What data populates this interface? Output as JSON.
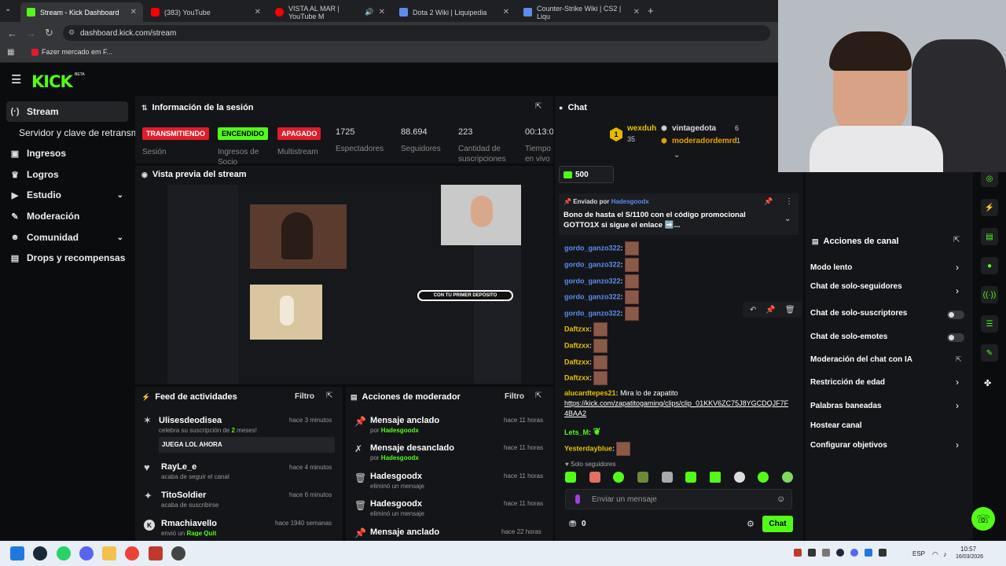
{
  "browser": {
    "tabs": [
      {
        "title": "Stream - Kick Dashboard",
        "color": "#53fc18"
      },
      {
        "title": "(383) YouTube",
        "color": "#ff0000"
      },
      {
        "title": "VISTA AL MAR | YouTube M",
        "color": "#ff0000"
      },
      {
        "title": "Dota 2 Wiki | Liquipedia",
        "color": "#5b8def"
      },
      {
        "title": "Counter-Strike Wiki | CS2 | Liqu",
        "color": "#5b8def"
      }
    ],
    "url": "dashboard.kick.com/stream",
    "bookmark": "Fazer mercado em F..."
  },
  "brand": {
    "logo": "KICK",
    "beta": "BETA"
  },
  "sidebar": {
    "items": [
      {
        "label": "Stream",
        "icon": "broadcast-icon",
        "glyph": "(·)"
      },
      {
        "label": "Servidor y clave de retransm",
        "icon": "",
        "glyph": ""
      },
      {
        "label": "Ingresos",
        "icon": "wallet-icon",
        "glyph": "▣"
      },
      {
        "label": "Logros",
        "icon": "trophy-icon",
        "glyph": "♛"
      },
      {
        "label": "Estudio",
        "icon": "video-icon",
        "glyph": "▶"
      },
      {
        "label": "Moderación",
        "icon": "wrench-icon",
        "glyph": "✎"
      },
      {
        "label": "Comunidad",
        "icon": "people-icon",
        "glyph": "☻"
      },
      {
        "label": "Drops y recompensas",
        "icon": "gift-icon",
        "glyph": "▤"
      }
    ]
  },
  "session": {
    "title": "Información de la sesión",
    "badges": [
      {
        "label": "TRANSMITIENDO",
        "sub": "Sesión",
        "bg": "#e11d2a",
        "fg": "#ffffff"
      },
      {
        "label": "ENCENDIDO",
        "sub": "Ingresos de Socio",
        "bg": "#53fc18",
        "fg": "#000000"
      },
      {
        "label": "APAGADO",
        "sub": "Multistream",
        "bg": "#e11d2a",
        "fg": "#ffffff"
      }
    ],
    "stats": [
      {
        "value": "1725",
        "label": "Espectadores"
      },
      {
        "value": "88.694",
        "label": "Seguidores"
      },
      {
        "value": "223",
        "label": "Cantidad de suscripciones"
      },
      {
        "value": "00:13:0",
        "label": "Tiempo en vivo"
      }
    ]
  },
  "preview": {
    "title": "Vista previa del stream",
    "banner": "CON TU PRIMER DEPÓSITO"
  },
  "feed": {
    "title": "Feed de actividades",
    "filter": "Filtro",
    "items": [
      {
        "name": "Ulisesdeodisea",
        "pre": "celebra su suscripción de ",
        "hl": "2",
        "post": " meses!",
        "time": "hace 3 minutos",
        "msg": "JUEGA LOL AHORA",
        "icon": "sub-icon"
      },
      {
        "name": "RayLe_e",
        "pre": "acaba de seguir el canal",
        "hl": "",
        "post": "",
        "time": "hace 4 minutos",
        "icon": "heart-icon"
      },
      {
        "name": "TitoSoldier",
        "pre": "acaba de suscribirse",
        "hl": "",
        "post": "",
        "time": "hace 6 minutos",
        "icon": "star-icon"
      },
      {
        "name": "Rmachiavello",
        "pre": "envió un ",
        "hl": "Rage Quit",
        "post": "",
        "time": "hace 1940 semanas",
        "icon": "kick-icon"
      }
    ]
  },
  "modactions": {
    "title": "Acciones de moderador",
    "filter": "Filtro",
    "items": [
      {
        "action": "Mensaje anclado",
        "sub": "por ",
        "user": "Hadesgoodx",
        "time": "hace 11 horas",
        "icon": "pin-icon"
      },
      {
        "action": "Mensaje desanclado",
        "sub": "por ",
        "user": "Hadesgoodx",
        "time": "hace 11 horas",
        "icon": "unpin-icon"
      },
      {
        "action": "Hadesgoodx",
        "sub": "eliminó un mensaje",
        "user": "",
        "time": "hace 11 horas",
        "icon": "trash-icon"
      },
      {
        "action": "Hadesgoodx",
        "sub": "eliminó un mensaje",
        "user": "",
        "time": "hace 11 horas",
        "icon": "trash-icon"
      },
      {
        "action": "Mensaje anclado",
        "sub": "",
        "user": "",
        "time": "hace 22 horas",
        "icon": "pin-icon"
      }
    ]
  },
  "chat": {
    "title": "Chat",
    "leaderboard": [
      {
        "name": "wexduh",
        "count": "35"
      },
      {
        "name": "vintagedota",
        "count": "6"
      },
      {
        "name": "moderadordemrd",
        "count": "1"
      }
    ],
    "goal": "500",
    "pinned": {
      "prefix": "Enviado por",
      "user": "Hadesgoodx",
      "text": "Bono de hasta el S/1100 con el código promocional GOTTO1X si sigue el enlace ➡️..."
    },
    "messages": [
      {
        "user": "gordo_ganzo322",
        "text": "",
        "color": "#5b8def"
      },
      {
        "user": "gordo_ganzo322",
        "text": "",
        "color": "#5b8def"
      },
      {
        "user": "gordo_ganzo322",
        "text": "",
        "color": "#5b8def"
      },
      {
        "user": "gordo_ganzo322",
        "text": "",
        "color": "#5b8def"
      },
      {
        "user": "gordo_ganzo322",
        "text": "",
        "color": "#5b8def"
      },
      {
        "user": "Daftzxx",
        "text": "",
        "color": "#e6c200"
      },
      {
        "user": "Daftzxx",
        "text": "",
        "color": "#e6c200"
      },
      {
        "user": "Daftzxx",
        "text": "",
        "color": "#e6c200"
      },
      {
        "user": "Daftzxx",
        "text": "",
        "color": "#e6c200"
      }
    ],
    "last": {
      "user": "alucardtepes21",
      "text": "Mira lo de zapatito",
      "link": "https://kick.com/zapatitogaming/clips/clip_01KKV6ZC75J8YGCDQJF7F4BAA2"
    },
    "lets": "Lets_M",
    "yesterday": "Yesterdayblue",
    "followers_only": "Solo seguidores",
    "placeholder": "Enviar un mensaje",
    "points": "0",
    "send": "Chat"
  },
  "actions": {
    "title": "Acciones de canal",
    "items": [
      {
        "label": "Modo lento",
        "type": "chevron"
      },
      {
        "label": "Chat de solo-seguidores",
        "type": "chevron"
      },
      {
        "label": "Chat de solo-suscriptores",
        "type": "toggle"
      },
      {
        "label": "Chat de solo-emotes",
        "type": "toggle"
      },
      {
        "label": "Moderación del chat con IA",
        "type": "link"
      },
      {
        "label": "Restricción de edad",
        "type": "chevron"
      },
      {
        "label": "Palabras baneadas",
        "type": "chevron"
      },
      {
        "label": "Hostear canal",
        "type": "none"
      },
      {
        "label": "Configurar objetivos",
        "type": "chevron"
      }
    ]
  },
  "taskbar": {
    "lang": "ESP",
    "time": "10:57",
    "date": "16/03/2026"
  }
}
